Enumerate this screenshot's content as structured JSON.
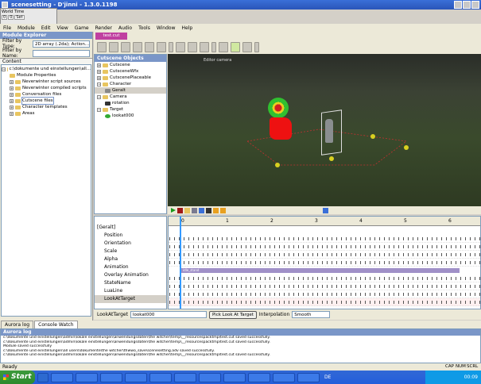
{
  "window": {
    "title": "scenesetting - D'jinni - 1.3.0.1198"
  },
  "world_time": {
    "label": "World Time",
    "fields": [
      "0",
      "0",
      "Set"
    ]
  },
  "menu": [
    "File",
    "Module",
    "Edit",
    "View",
    "Game",
    "Render",
    "Audio",
    "Tools",
    "Window",
    "Help"
  ],
  "module_explorer": {
    "title": "Module Explorer",
    "filter_type_label": "Filter by Type:",
    "filter_type_value": "2D array (.2da); Action...",
    "filter_name_label": "Filter by Name:",
    "filter_name_value": "",
    "content_label": "Content",
    "tree": [
      {
        "label": "c:\\dokumente und einstellungen\\all...",
        "level": 0
      },
      {
        "label": "Module Properties",
        "level": 1
      },
      {
        "label": "Neverwinter script sources",
        "level": 1
      },
      {
        "label": "Neverwinter compiled scripts",
        "level": 1
      },
      {
        "label": "Conversation files",
        "level": 1
      },
      {
        "label": "Cutscene files",
        "level": 1,
        "selected": true
      },
      {
        "label": "Character templates",
        "level": 1
      },
      {
        "label": "Areas",
        "level": 1
      }
    ]
  },
  "editor_tab": {
    "label": "test.cut"
  },
  "cutscene_objects": {
    "title": "Cutscene Objects",
    "tree": [
      {
        "label": "Cutscene",
        "level": 0
      },
      {
        "label": "CutsceneWfx",
        "level": 0
      },
      {
        "label": "CutscenePlaceable",
        "level": 0
      },
      {
        "label": "Character",
        "level": 0
      },
      {
        "label": "Geralt",
        "level": 1,
        "selected": true
      },
      {
        "label": "Camera",
        "level": 0
      },
      {
        "label": "rotation",
        "level": 1
      },
      {
        "label": "Target",
        "level": 0
      },
      {
        "label": "lookat000",
        "level": 1
      }
    ]
  },
  "viewport": {
    "overlay_label": "Editor camera"
  },
  "timeline": {
    "root_label": "[Geralt]",
    "tracks": [
      "Position",
      "Orientation",
      "Scale",
      "Alpha",
      "Animation",
      "Overlay Animation",
      "StateName",
      "LuaLine",
      "LookAtTarget"
    ],
    "selected_track": "LookAtTarget",
    "ruler_ticks": [
      "0",
      "1",
      "2",
      "3",
      "4",
      "5",
      "6"
    ],
    "animation_clip": "idle_stand"
  },
  "lookat_bar": {
    "label": "LookAtTarget",
    "value": "lookat000",
    "pick_button": "Pick Look At Target",
    "interpolation_label": "Interpolation",
    "interpolation_value": "Smooth"
  },
  "bottom_tabs": [
    "Aurora log",
    "Console Watch"
  ],
  "log": {
    "title": "Aurora log",
    "lines": [
      "c:\\dokumente und einstellungen\\admin\\lokale einstellungen\\anwendungsdaten\\the witcher\\temp\\__resourcespacktmp\\test.cut saved successfully.",
      "c:\\dokumente und einstellungen\\admin\\lokale einstellungen\\anwendungsdaten\\the witcher\\temp\\__resourcespacktmp\\test.cut saved successfully.",
      "Module saved successfully",
      "c:\\dokumente und einstellungen\\all users\\dokumente\\the witcher\\thwwo_save\\scenesetting.adv saved successfully.",
      "c:\\dokumente und einstellungen\\admin\\lokale einstellungen\\anwendungsdaten\\the witcher\\temp\\__resourcespacktmp\\test.cut saved successfully."
    ]
  },
  "status": {
    "text": "Ready",
    "indicators": [
      "CAP",
      "NUM",
      "SCRL"
    ]
  },
  "taskbar": {
    "start": "Start",
    "items": [
      "",
      "",
      "",
      "",
      "",
      "",
      "",
      "",
      "",
      "",
      "",
      "",
      ""
    ],
    "lang": "DE",
    "clock": "00:09"
  }
}
